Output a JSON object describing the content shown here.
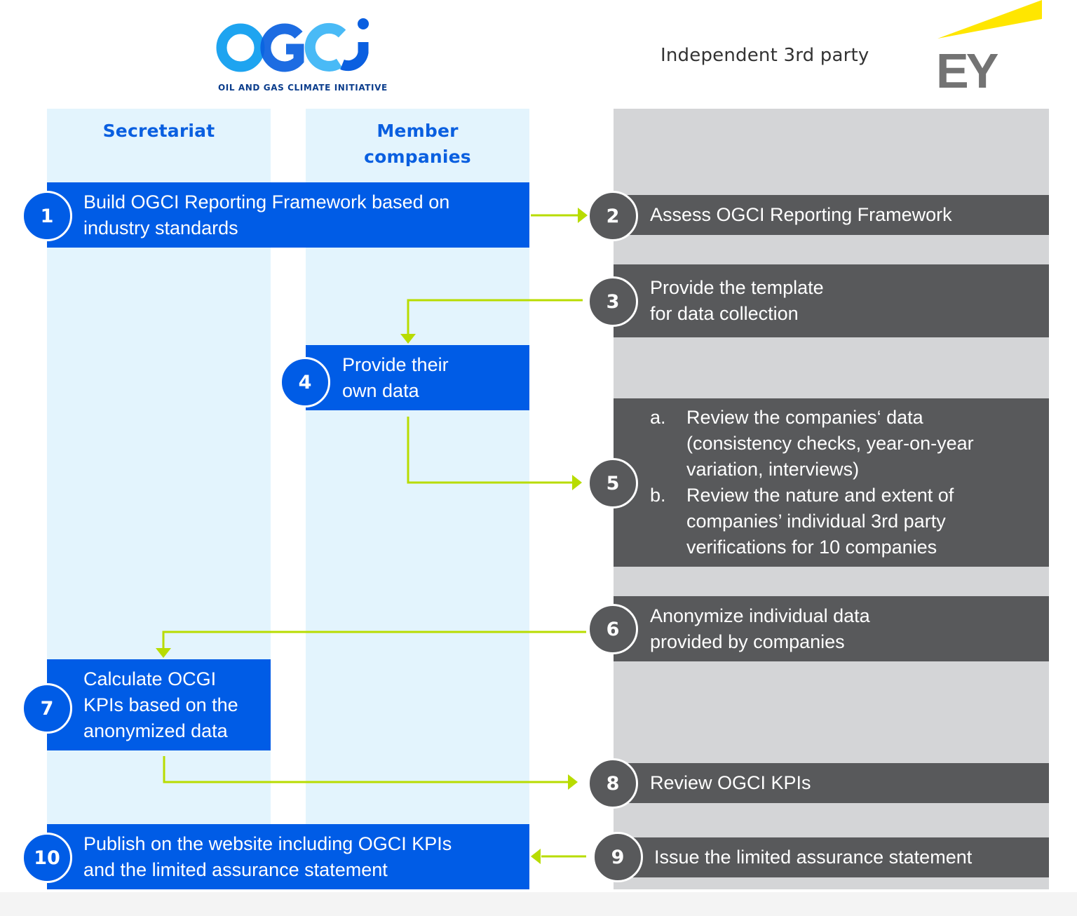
{
  "header": {
    "ogci_logo_text": "OGCi",
    "ogci_subtitle": "OIL AND GAS CLIMATE INITIATIVE",
    "third_party_label": "Independent 3rd party",
    "ey_logo_text": "EY"
  },
  "lanes": {
    "secretariat": "Secretariat",
    "member_companies": "Member\ncompanies"
  },
  "colors": {
    "ogci_blue": "#005ce6",
    "lane_light_blue": "#e3f4fd",
    "ey_lane_grey": "#d4d5d7",
    "ey_box_dark": "#58595b",
    "arrow_green": "#b8dc00",
    "ey_yellow": "#ffe600"
  },
  "steps": [
    {
      "number": "1",
      "owner": "secretariat+members",
      "text": "Build OGCI Reporting Framework based on\nindustry standards"
    },
    {
      "number": "2",
      "owner": "ey",
      "text": "Assess OGCI Reporting Framework"
    },
    {
      "number": "3",
      "owner": "ey",
      "text": "Provide the template\nfor data collection"
    },
    {
      "number": "4",
      "owner": "members",
      "text": "Provide their\nown data"
    },
    {
      "number": "5",
      "owner": "ey",
      "items": [
        {
          "marker": "a.",
          "text": "Review the companies‘ data\n(consistency checks, year-on-year\nvariation, interviews)"
        },
        {
          "marker": "b.",
          "text": "Review the nature and extent of\ncompanies’ individual 3rd party\nverifications for 10 companies"
        }
      ]
    },
    {
      "number": "6",
      "owner": "ey",
      "text": "Anonymize individual data\nprovided by companies"
    },
    {
      "number": "7",
      "owner": "secretariat",
      "text": "Calculate OCGI\nKPIs based on the\nanonymized data"
    },
    {
      "number": "8",
      "owner": "ey",
      "text": "Review OGCI KPIs"
    },
    {
      "number": "9",
      "owner": "ey",
      "text": "Issue the limited assurance statement"
    },
    {
      "number": "10",
      "owner": "secretariat+members",
      "text": "Publish on the website including OGCI KPIs\nand the limited assurance statement"
    }
  ],
  "flows": [
    {
      "from": "1",
      "to": "2"
    },
    {
      "from": "3",
      "to": "4"
    },
    {
      "from": "4",
      "to": "5"
    },
    {
      "from": "6",
      "to": "7"
    },
    {
      "from": "7",
      "to": "8"
    },
    {
      "from": "9",
      "to": "10"
    }
  ]
}
